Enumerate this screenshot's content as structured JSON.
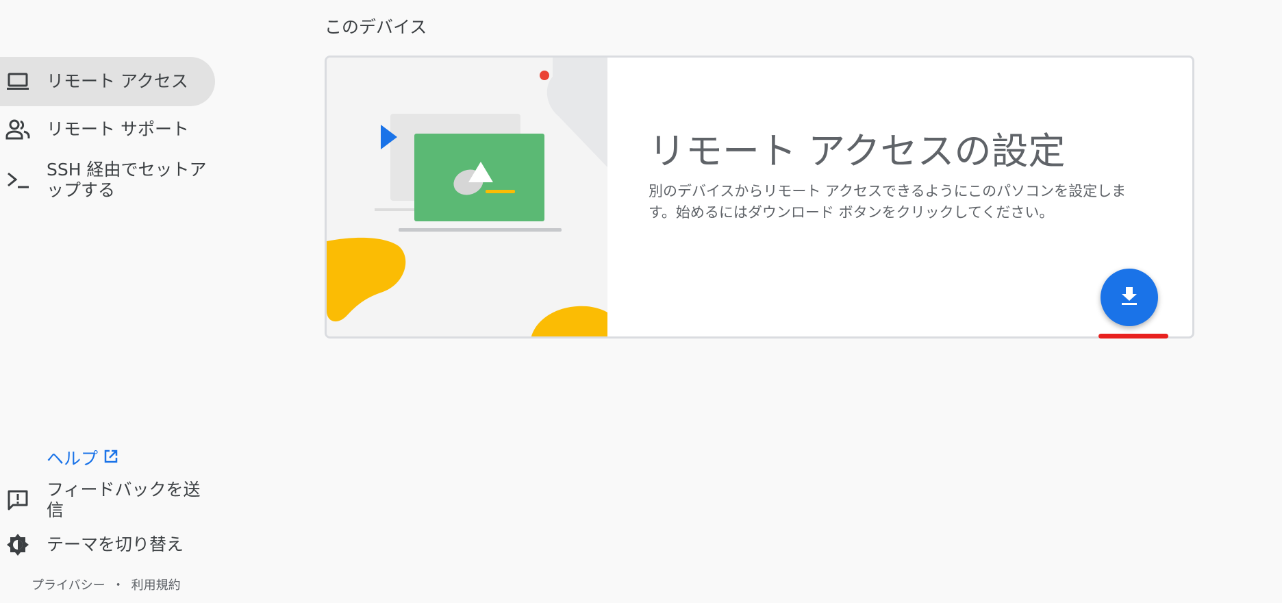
{
  "sidebar": {
    "items": [
      {
        "label": "リモート アクセス",
        "icon": "laptop-icon"
      },
      {
        "label": "リモート サポート",
        "icon": "people-icon"
      },
      {
        "label": "SSH 経由でセットアップする",
        "icon": "terminal-icon"
      }
    ],
    "help": {
      "label": "ヘルプ",
      "icon": "open-in-new-icon"
    },
    "feedback": {
      "label": "フィードバックを送信",
      "icon": "feedback-icon"
    },
    "theme": {
      "label": "テーマを切り替え",
      "icon": "brightness-icon"
    },
    "footer": {
      "privacy": "プライバシー",
      "separator": "・",
      "terms": "利用規約"
    }
  },
  "main": {
    "section_title": "このデバイス",
    "card": {
      "title": "リモート アクセスの設定",
      "description": "別のデバイスからリモート アクセスできるようにこのパソコンを設定します。始めるにはダウンロード ボタンをクリックしてください。",
      "download_icon": "download-icon"
    }
  },
  "colors": {
    "accent": "#1a73e8",
    "active_nav": "#e2e2e2",
    "highlight_underline": "#e8211f",
    "illustration_green": "#5bb974",
    "illustration_yellow": "#fbbc04"
  }
}
